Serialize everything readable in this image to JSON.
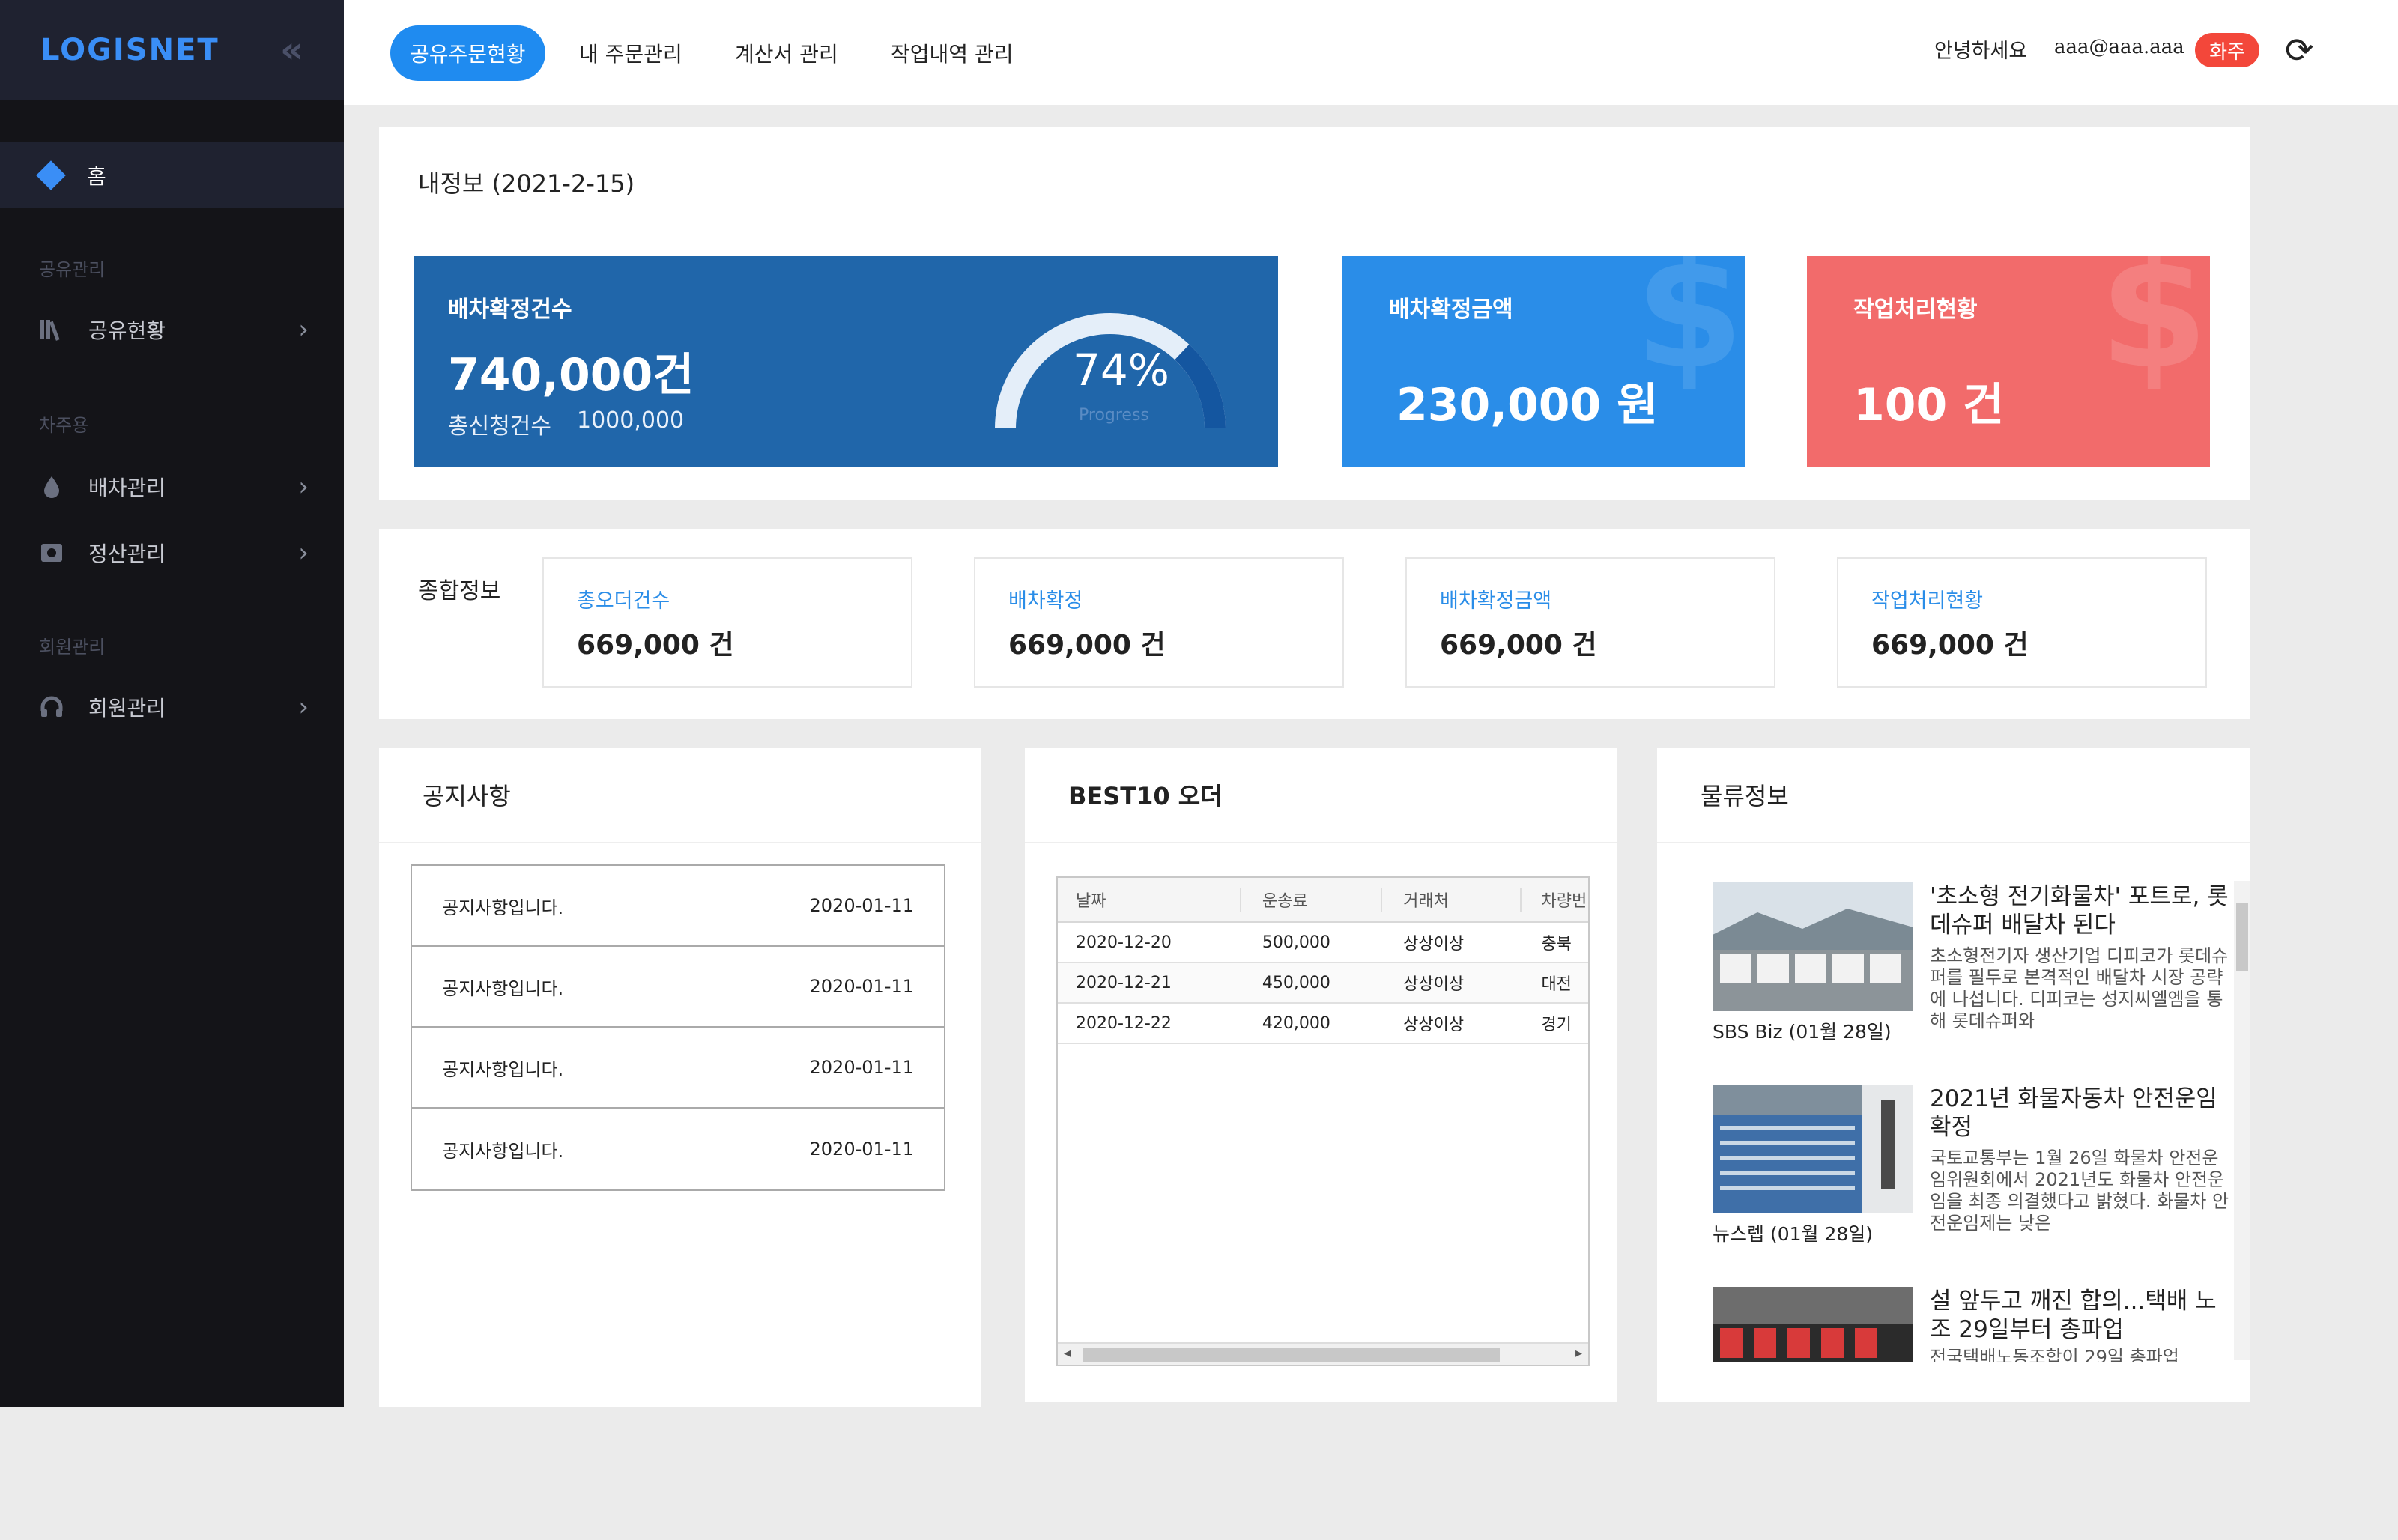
{
  "sidebar": {
    "logo": "LOGISNET",
    "collapse_icon": "«",
    "home_label": "홈",
    "sections": [
      {
        "label": "공유관리",
        "items": [
          {
            "label": "공유현황"
          }
        ]
      },
      {
        "label": "차주용",
        "items": [
          {
            "label": "배차관리"
          },
          {
            "label": "정산관리"
          }
        ]
      },
      {
        "label": "회원관리",
        "items": [
          {
            "label": "회원관리"
          }
        ]
      }
    ]
  },
  "topbar": {
    "tabs": [
      "공유주문현황",
      "내 주문관리",
      "계산서 관리",
      "작업내역 관리"
    ],
    "greeting": "안녕하세요",
    "email": "aaa@aaa.aaa",
    "role": "화주"
  },
  "info": {
    "title": "내정보 (2021-2-15)",
    "dispatch": {
      "title": "배차확정건수",
      "value": "740,000건",
      "sub_label": "총신청건수",
      "sub_value": "1000,000",
      "percent_label": "74%",
      "progress_label": "Progress",
      "progress": 0.74
    },
    "amount": {
      "title": "배차확정금액",
      "value": "230,000 원"
    },
    "work": {
      "title": "작업처리현황",
      "value": "100 건"
    },
    "colors": {
      "blue_dark": "#2066aa",
      "blue": "#2a8de8",
      "red": "#f26b6b"
    }
  },
  "summary": {
    "title": "종합정보",
    "items": [
      {
        "label": "총오더건수",
        "value": "669,000 건"
      },
      {
        "label": "배차확정",
        "value": "669,000 건"
      },
      {
        "label": "배차확정금액",
        "value": "669,000 건"
      },
      {
        "label": "작업처리현황",
        "value": "669,000 건"
      }
    ]
  },
  "notices": {
    "title": "공지사항",
    "rows": [
      {
        "text": "공지사항입니다.",
        "date": "2020-01-11"
      },
      {
        "text": "공지사항입니다.",
        "date": "2020-01-11"
      },
      {
        "text": "공지사항입니다.",
        "date": "2020-01-11"
      },
      {
        "text": "공지사항입니다.",
        "date": "2020-01-11"
      }
    ]
  },
  "best10": {
    "title": "BEST10 오더",
    "columns": [
      "날짜",
      "운송료",
      "거래처",
      "차량번"
    ],
    "rows": [
      [
        "2020-12-20",
        "500,000",
        "상상이상",
        "충북"
      ],
      [
        "2020-12-21",
        "450,000",
        "상상이상",
        "대전"
      ],
      [
        "2020-12-22",
        "420,000",
        "상상이상",
        "경기"
      ]
    ]
  },
  "logistics": {
    "title": "물류정보",
    "news": [
      {
        "title": "'초소형 전기화물차' 포트로, 롯데슈퍼 배달차 된다",
        "body": "초소형전기자 생산기업 디피코가 롯데슈퍼를 필두로 본격적인 배달차 시장 공략에 나섭니다. 디피코는 성지씨엘엠을 통해 롯데슈퍼와",
        "source": "SBS Biz (01월 28일)"
      },
      {
        "title": "2021년 화물자동차 안전운임 확정",
        "body": "국토교통부는 1월 26일 화물차 안전운임위원회에서 2021년도 화물차 안전운임을 최종 의결했다고 밝혔다. 화물차 안전운임제는 낮은",
        "source": "뉴스렙 (01월 28일)"
      },
      {
        "title": "설 앞두고 깨진 합의...택배 노조 29일부터 총파업",
        "body": "전국택배노동조합이 29일 총파업",
        "source": ""
      }
    ]
  }
}
